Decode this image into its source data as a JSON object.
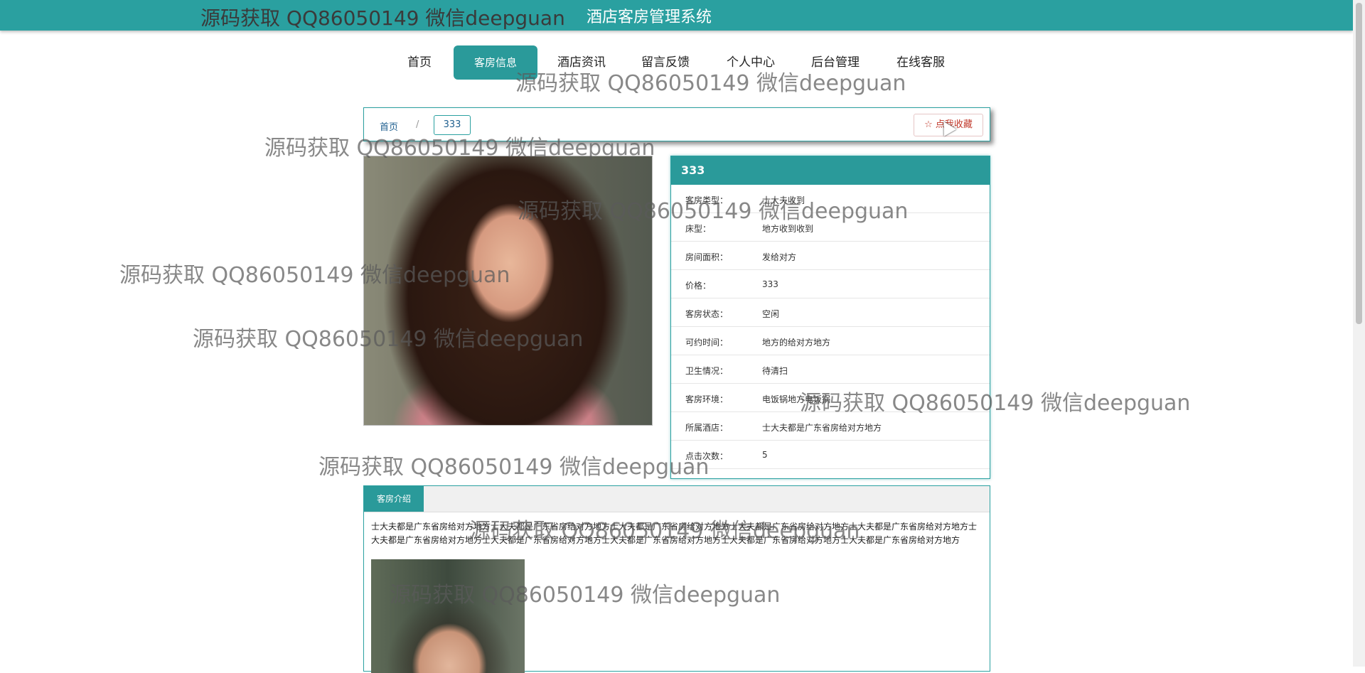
{
  "header": {
    "watermark": "源码获取 QQ86050149 微信deepguan",
    "system_title": "酒店客房管理系统"
  },
  "nav": {
    "items": [
      {
        "label": "首页"
      },
      {
        "label": "客房信息",
        "active": true
      },
      {
        "label": "酒店资讯"
      },
      {
        "label": "留言反馈"
      },
      {
        "label": "个人中心"
      },
      {
        "label": "后台管理"
      },
      {
        "label": "在线客服"
      }
    ]
  },
  "breadcrumb": {
    "home": "首页",
    "separator": "/",
    "current": "333",
    "favorite_label": "☆ 点我收藏"
  },
  "room": {
    "title": "333",
    "fields": [
      {
        "label": "客房类型：",
        "value": "士大夫收到"
      },
      {
        "label": "床型：",
        "value": "地方收到收到"
      },
      {
        "label": "房间面积：",
        "value": "发给对方"
      },
      {
        "label": "价格：",
        "value": "333"
      },
      {
        "label": "客房状态：",
        "value": "空闲"
      },
      {
        "label": "可约时间：",
        "value": "地方的给对方地方"
      },
      {
        "label": "卫生情况：",
        "value": "待清扫"
      },
      {
        "label": "客房环境：",
        "value": "电饭锅地方电饭锅"
      },
      {
        "label": "所属酒店：",
        "value": "士大夫都是广东省房给对方地方"
      },
      {
        "label": "点击次数：",
        "value": "5"
      }
    ]
  },
  "intro": {
    "tab_label": "客房介绍",
    "text": "士大夫都是广东省房给对方地方士大夫都是广东省房给对方地方士大夫都是广东省房给对方地方士大夫都是广东省房给对方地方士大夫都是广东省房给对方地方士大夫都是广东省房给对方地方士大夫都是广东省房给对方地方士大夫都是广东省房给对方地方士大夫都是广东省房给对方地方士大夫都是广东省房给对方地方"
  },
  "watermarks": [
    "源码获取 QQ86050149 微信deepguan",
    "源码获取 QQ86050149 微信deepguan",
    "源码获取 QQ86050149 微信deepguan",
    "源码获取 QQ86050149 微信deepguan",
    "源码获取 QQ86050149 微信deepguan",
    "源码获取 QQ86050149 微信deepguan",
    "源码获取 QQ86050149 微信deepguan",
    "源码获取 QQ86050149 微信deepguan",
    "源码获取 QQ86050149 微信deepguan"
  ],
  "colors": {
    "accent": "#2aa0a0",
    "accent_dark": "#2a9a9a",
    "favorite": "#c0392b"
  }
}
